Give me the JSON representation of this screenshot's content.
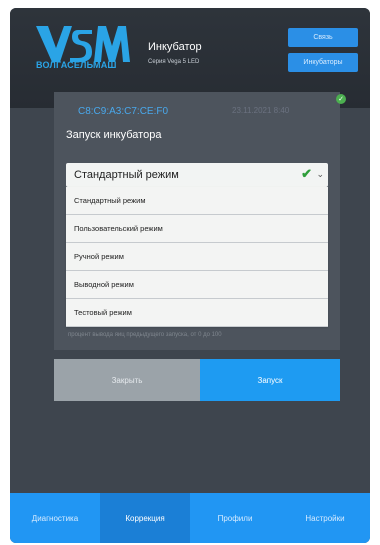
{
  "header": {
    "brand": "ВОЛГАСЕЛЬМАШ",
    "title": "Инкубатор",
    "subtitle": "Серия Vega 5 LED",
    "connect_label": "Связь",
    "incubators_label": "Инкубаторы"
  },
  "card": {
    "mac": "C8:C9:A3:C7:CE:F0",
    "date": "23.11.2021 8:40",
    "status_icon": "check-icon"
  },
  "modal": {
    "title": "Запуск инкубатора",
    "selected_mode": "Стандартный режим",
    "options": [
      "Стандартный режим",
      "Пользовательский режим",
      "Ручной режим",
      "Выводной режим",
      "Тестовый режим"
    ],
    "hint": "процент вывода яиц предыдущего запуска, от 0 до 100",
    "close_label": "Закрыть",
    "start_label": "Запуск"
  },
  "nav": {
    "tabs": [
      "Диагностика",
      "Коррекция",
      "Профили",
      "Настройки"
    ],
    "active_index": 1
  },
  "colors": {
    "accent": "#2196f3",
    "active_tab": "#1b7fd6",
    "mac_text": "#49a8ec",
    "check": "#2e9e3a"
  }
}
